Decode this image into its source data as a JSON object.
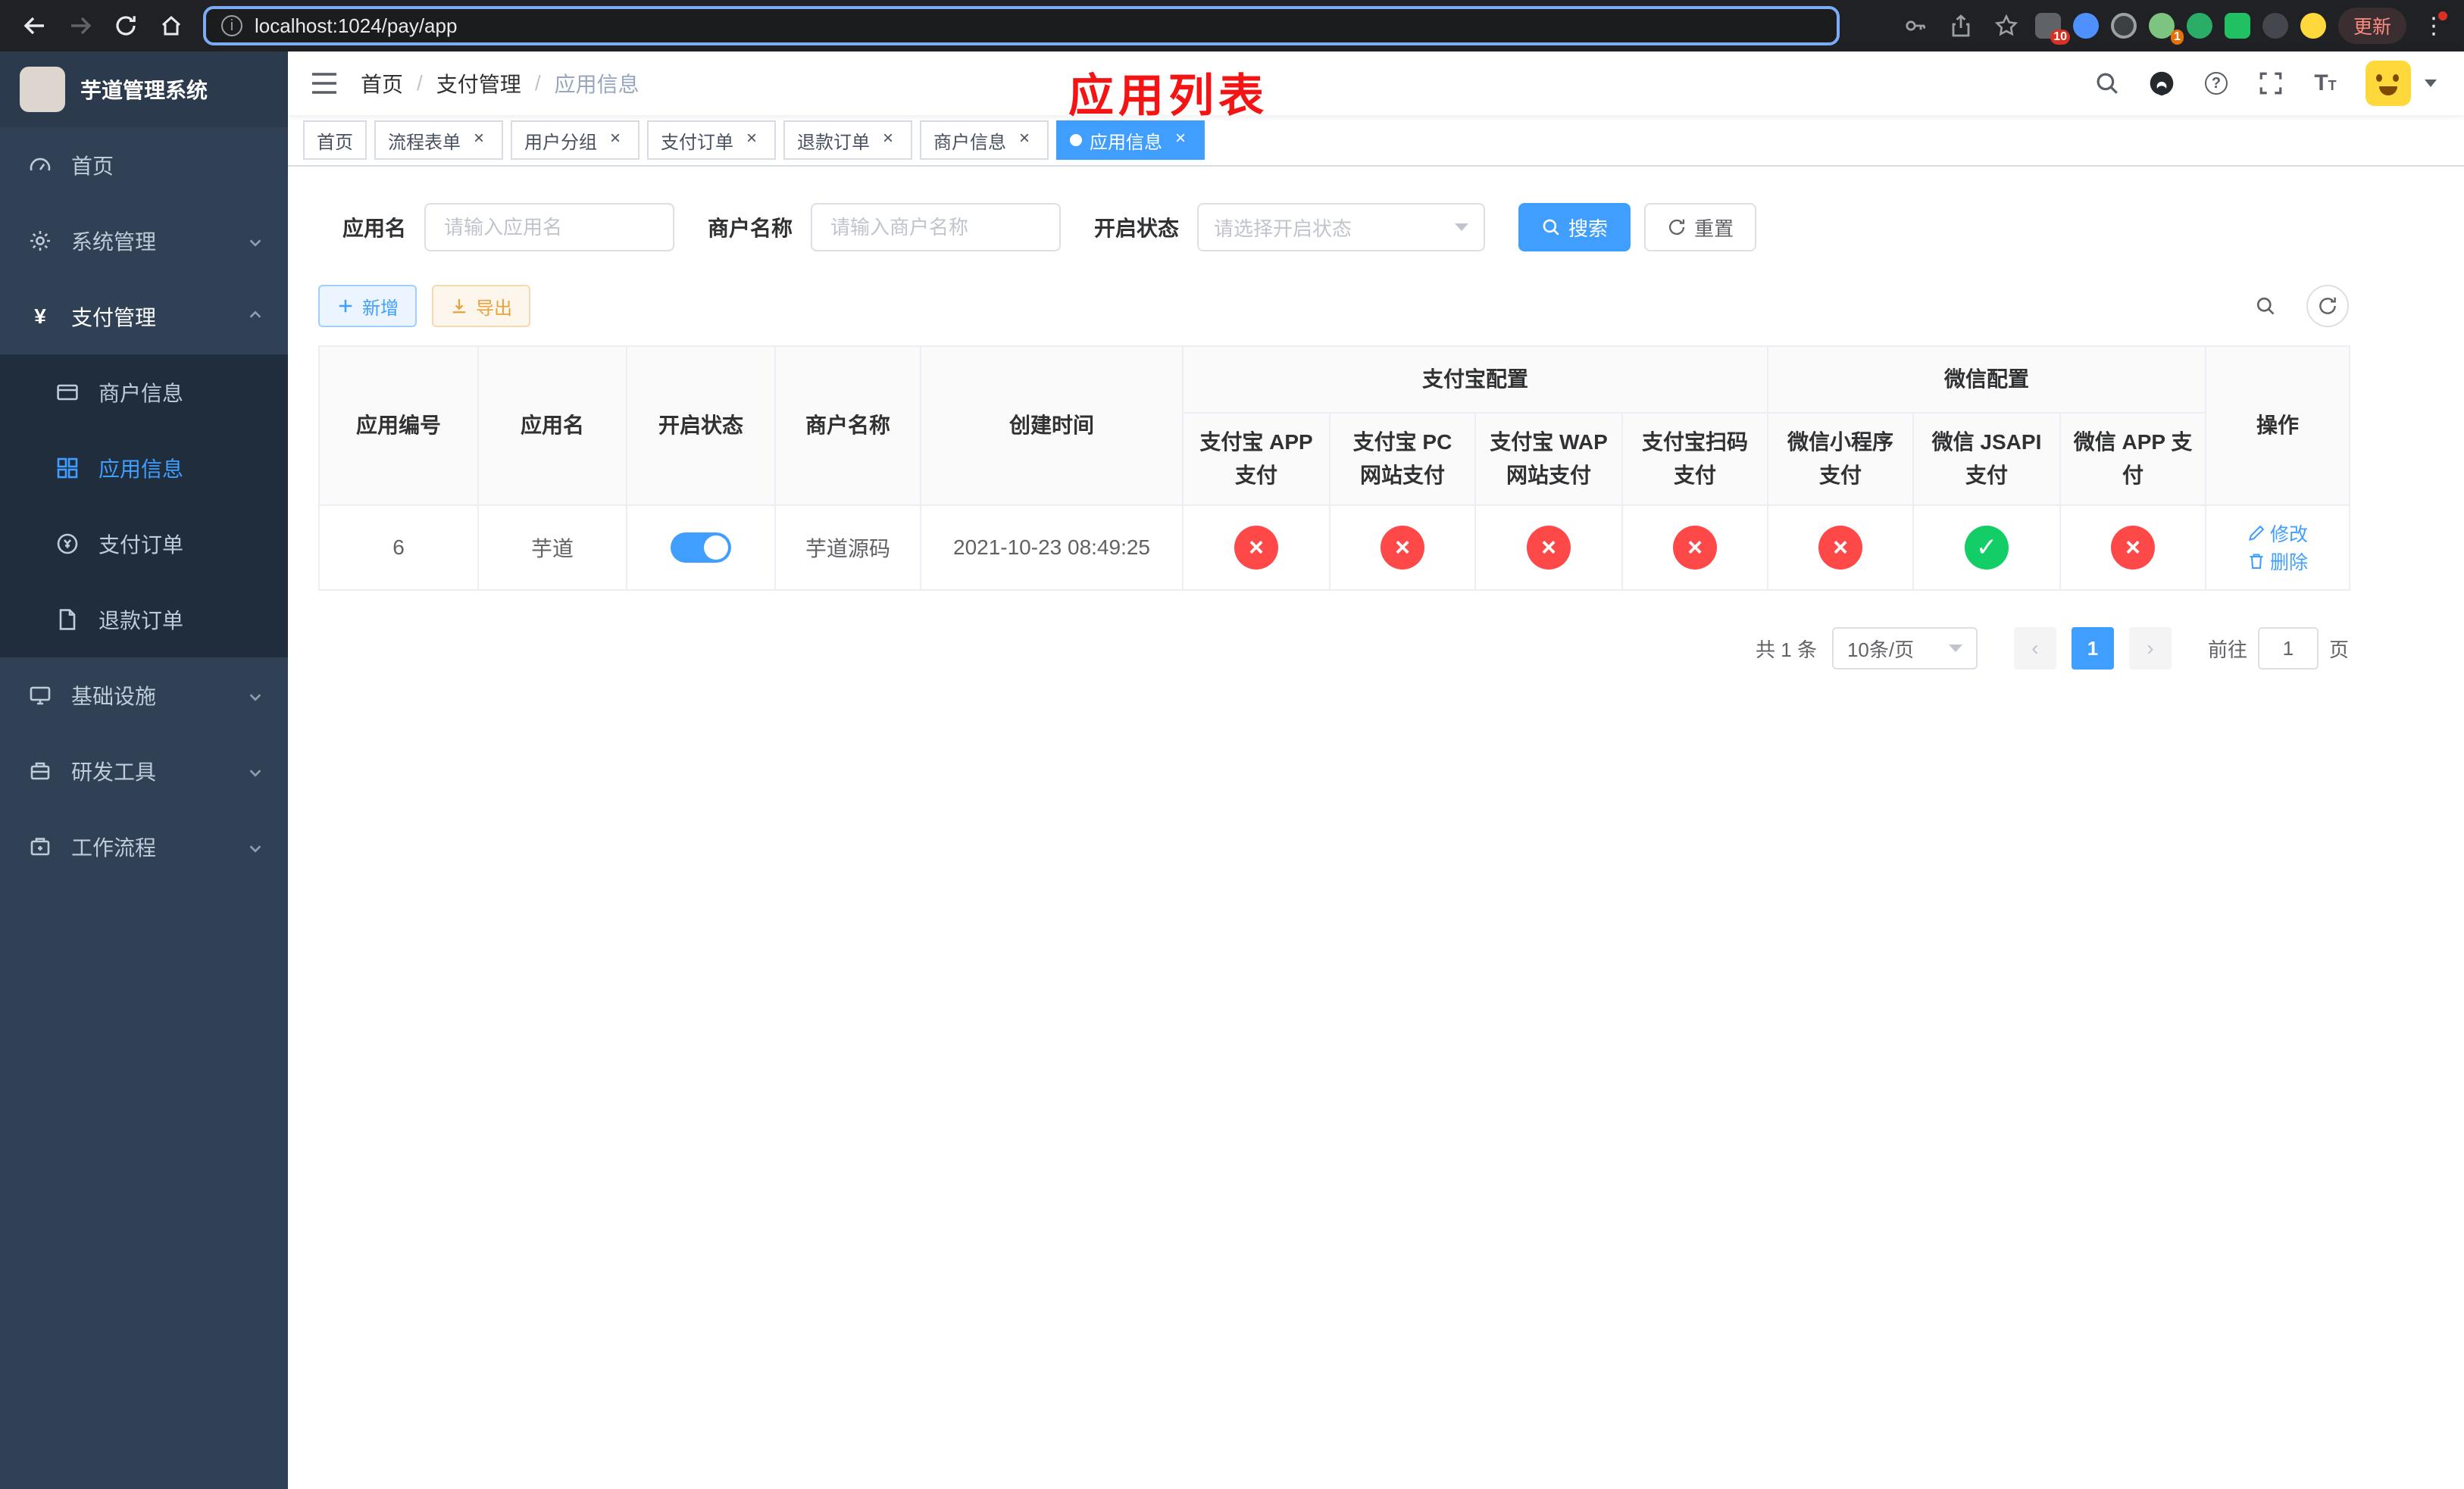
{
  "colors": {
    "primary": "#409eff",
    "success": "#13ce66",
    "danger": "#ff4949",
    "warning": "#e6a23c",
    "sidebar_bg": "#304156",
    "submenu_bg": "#1f2d3d",
    "annotation_red": "#f51414"
  },
  "browser": {
    "url": "localhost:1024/pay/app",
    "update_label": "更新",
    "extensions_badge": "10",
    "profile_badge": "1"
  },
  "sidebar": {
    "title": "芋道管理系统",
    "items": [
      {
        "label": "首页"
      },
      {
        "label": "系统管理"
      },
      {
        "label": "支付管理",
        "children": [
          {
            "label": "商户信息"
          },
          {
            "label": "应用信息"
          },
          {
            "label": "支付订单"
          },
          {
            "label": "退款订单"
          }
        ]
      },
      {
        "label": "基础设施"
      },
      {
        "label": "研发工具"
      },
      {
        "label": "工作流程"
      }
    ]
  },
  "header": {
    "breadcrumb": [
      "首页",
      "支付管理",
      "应用信息"
    ],
    "annotation": "应用列表"
  },
  "tabs": [
    {
      "label": "首页"
    },
    {
      "label": "流程表单"
    },
    {
      "label": "用户分组"
    },
    {
      "label": "支付订单"
    },
    {
      "label": "退款订单"
    },
    {
      "label": "商户信息"
    },
    {
      "label": "应用信息"
    }
  ],
  "filters": {
    "app_name_label": "应用名",
    "app_name_placeholder": "请输入应用名",
    "merchant_label": "商户名称",
    "merchant_placeholder": "请输入商户名称",
    "status_label": "开启状态",
    "status_placeholder": "请选择开启状态",
    "search_label": "搜索",
    "reset_label": "重置"
  },
  "toolbar": {
    "add_label": "新增",
    "export_label": "导出"
  },
  "table": {
    "columns": [
      "应用编号",
      "应用名",
      "开启状态",
      "商户名称",
      "创建时间",
      "操作"
    ],
    "groups": {
      "alipay": "支付宝配置",
      "wechat": "微信配置"
    },
    "alipay_columns": [
      "支付宝 APP 支付",
      "支付宝 PC 网站支付",
      "支付宝 WAP 网站支付",
      "支付宝扫码支付"
    ],
    "wechat_columns": [
      "微信小程序支付",
      "微信 JSAPI 支付",
      "微信 APP 支付"
    ],
    "rows": [
      {
        "id": "6",
        "name": "芋道",
        "enabled": true,
        "merchant": "芋道源码",
        "created": "2021-10-23 08:49:25",
        "alipay": [
          false,
          false,
          false,
          false
        ],
        "wechat": [
          false,
          true,
          false
        ],
        "edit_label": "修改",
        "delete_label": "删除"
      }
    ]
  },
  "pagination": {
    "total": "共 1 条",
    "page_size": "10条/页",
    "page": "1",
    "goto_label": "前往",
    "goto_value": "1",
    "unit_label": "页"
  }
}
